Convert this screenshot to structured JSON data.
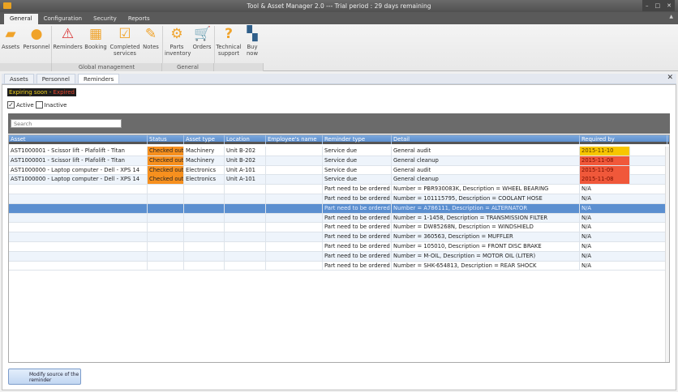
{
  "window": {
    "title": "Tool & Asset Manager 2.0 --- Trial period : 29 days remaining",
    "minimize": "–",
    "maximize": "□",
    "close": "✕"
  },
  "ribbon_tabs": [
    "General",
    "Configuration",
    "Security",
    "Reports"
  ],
  "ribbon": {
    "buttons": [
      {
        "label": "Assets",
        "icon": "assets-icon"
      },
      {
        "label": "Personnel",
        "icon": "personnel-icon"
      },
      {
        "label": "Reminders",
        "icon": "warning-icon"
      },
      {
        "label": "Booking",
        "icon": "calendar-icon"
      },
      {
        "label": "Completed services",
        "icon": "completed-icon"
      },
      {
        "label": "Notes",
        "icon": "notes-icon"
      },
      {
        "label": "Parts inventory",
        "icon": "gears-icon"
      },
      {
        "label": "Orders",
        "icon": "cart-icon"
      },
      {
        "label": "Technical support",
        "icon": "question-icon"
      },
      {
        "label": "Buy now",
        "icon": "buy-icon"
      }
    ],
    "groups": [
      "Global management",
      "General"
    ]
  },
  "doc_tabs": [
    "Assets",
    "Personnel",
    "Reminders"
  ],
  "legend": {
    "soon": "Expiring soon",
    "sep": " - ",
    "expired": "Expired"
  },
  "filters": {
    "active": "Active",
    "inactive": "Inactive",
    "active_checked": true,
    "inactive_checked": false
  },
  "search": {
    "placeholder": "Search"
  },
  "colors": {
    "soon": "#f7c600",
    "expired": "#f0583a",
    "checked_out": "#f7901e",
    "selected": "#5b8fd0"
  },
  "grid": {
    "columns": [
      "Asset",
      "Status",
      "Asset type",
      "Location",
      "Employee's name",
      "Reminder type",
      "Detail",
      "Required by"
    ],
    "rows": [
      {
        "asset": "AST1000001 - Scissor lift - Plafolift - Titan",
        "status": "Checked out",
        "type": "Machinery",
        "location": "Unit B-202",
        "employee": "",
        "reminder": "Service due",
        "detail": "General audit",
        "required": "2015-11-10",
        "level": "soon"
      },
      {
        "asset": "AST1000001 - Scissor lift - Plafolift - Titan",
        "status": "Checked out",
        "type": "Machinery",
        "location": "Unit B-202",
        "employee": "",
        "reminder": "Service due",
        "detail": "General cleanup",
        "required": "2015-11-08",
        "level": "expired"
      },
      {
        "asset": "AST1000000 - Laptop computer - Dell - XPS 14",
        "status": "Checked out",
        "type": "Electronics",
        "location": "Unit A-101",
        "employee": "",
        "reminder": "Service due",
        "detail": "General audit",
        "required": "2015-11-09",
        "level": "expired"
      },
      {
        "asset": "AST1000000 - Laptop computer - Dell - XPS 14",
        "status": "Checked out",
        "type": "Electronics",
        "location": "Unit A-101",
        "employee": "",
        "reminder": "Service due",
        "detail": "General cleanup",
        "required": "2015-11-08",
        "level": "expired"
      },
      {
        "asset": "",
        "status": "",
        "type": "",
        "location": "",
        "employee": "",
        "reminder": "Part need to be ordered",
        "detail": "Number = PBR930083K, Description = WHEEL BEARING",
        "required": "N/A"
      },
      {
        "asset": "",
        "status": "",
        "type": "",
        "location": "",
        "employee": "",
        "reminder": "Part need to be ordered",
        "detail": "Number = 101115795, Description = COOLANT HOSE",
        "required": "N/A"
      },
      {
        "asset": "",
        "status": "",
        "type": "",
        "location": "",
        "employee": "",
        "reminder": "Part need to be ordered",
        "detail": "Number = A786111, Description = ALTERNATOR",
        "required": "N/A",
        "selected": true
      },
      {
        "asset": "",
        "status": "",
        "type": "",
        "location": "",
        "employee": "",
        "reminder": "Part need to be ordered",
        "detail": "Number = 1-1458, Description = TRANSMISSION FILTER",
        "required": "N/A"
      },
      {
        "asset": "",
        "status": "",
        "type": "",
        "location": "",
        "employee": "",
        "reminder": "Part need to be ordered",
        "detail": "Number = DW85268N, Description = WINDSHIELD",
        "required": "N/A"
      },
      {
        "asset": "",
        "status": "",
        "type": "",
        "location": "",
        "employee": "",
        "reminder": "Part need to be ordered",
        "detail": "Number = 360563, Description = MUFFLER",
        "required": "N/A"
      },
      {
        "asset": "",
        "status": "",
        "type": "",
        "location": "",
        "employee": "",
        "reminder": "Part need to be ordered",
        "detail": "Number = 105010, Description = FRONT DISC BRAKE",
        "required": "N/A"
      },
      {
        "asset": "",
        "status": "",
        "type": "",
        "location": "",
        "employee": "",
        "reminder": "Part need to be ordered",
        "detail": "Number = M-OIL, Description = MOTOR OIL (LITER)",
        "required": "N/A"
      },
      {
        "asset": "",
        "status": "",
        "type": "",
        "location": "",
        "employee": "",
        "reminder": "Part need to be ordered",
        "detail": "Number = SHK-654813, Description = REAR SHOCK",
        "required": "N/A"
      }
    ]
  },
  "footer": {
    "modify_button": "Modify source of the reminder"
  }
}
